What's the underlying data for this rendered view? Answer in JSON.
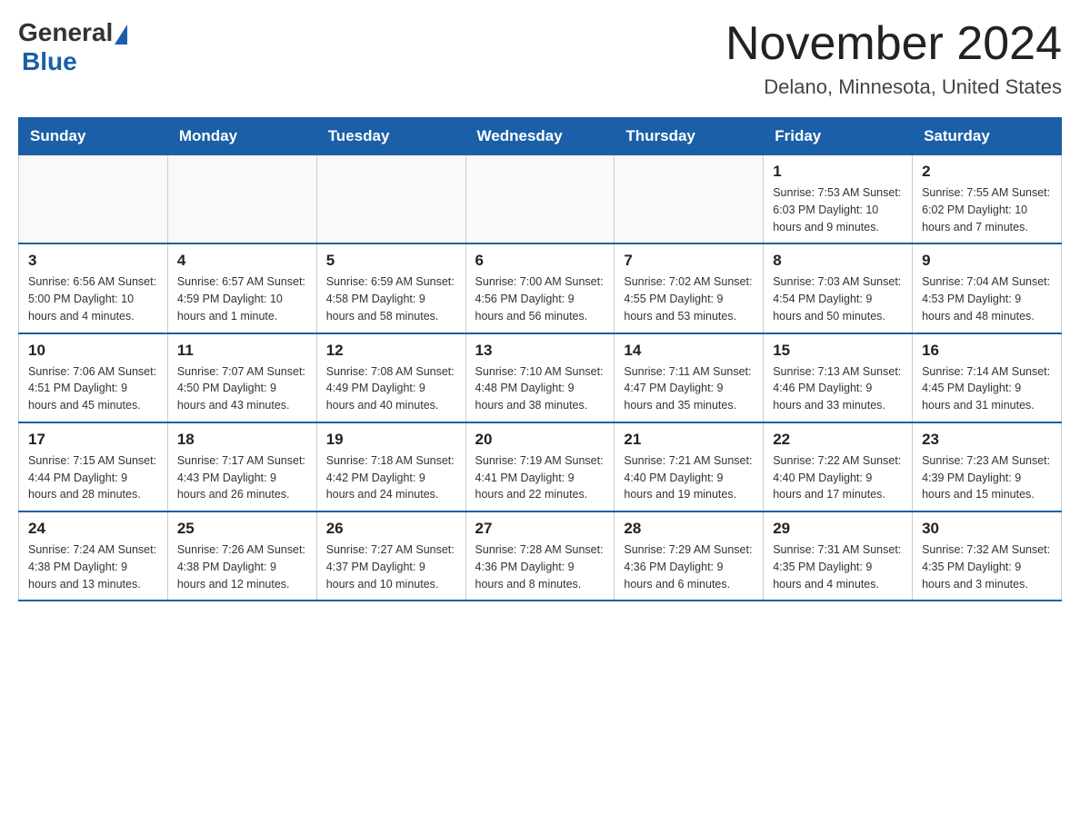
{
  "header": {
    "logo_general": "General",
    "logo_blue": "Blue",
    "month_title": "November 2024",
    "location": "Delano, Minnesota, United States"
  },
  "calendar": {
    "days_of_week": [
      "Sunday",
      "Monday",
      "Tuesday",
      "Wednesday",
      "Thursday",
      "Friday",
      "Saturday"
    ],
    "weeks": [
      [
        {
          "day": "",
          "info": ""
        },
        {
          "day": "",
          "info": ""
        },
        {
          "day": "",
          "info": ""
        },
        {
          "day": "",
          "info": ""
        },
        {
          "day": "",
          "info": ""
        },
        {
          "day": "1",
          "info": "Sunrise: 7:53 AM\nSunset: 6:03 PM\nDaylight: 10 hours and 9 minutes."
        },
        {
          "day": "2",
          "info": "Sunrise: 7:55 AM\nSunset: 6:02 PM\nDaylight: 10 hours and 7 minutes."
        }
      ],
      [
        {
          "day": "3",
          "info": "Sunrise: 6:56 AM\nSunset: 5:00 PM\nDaylight: 10 hours and 4 minutes."
        },
        {
          "day": "4",
          "info": "Sunrise: 6:57 AM\nSunset: 4:59 PM\nDaylight: 10 hours and 1 minute."
        },
        {
          "day": "5",
          "info": "Sunrise: 6:59 AM\nSunset: 4:58 PM\nDaylight: 9 hours and 58 minutes."
        },
        {
          "day": "6",
          "info": "Sunrise: 7:00 AM\nSunset: 4:56 PM\nDaylight: 9 hours and 56 minutes."
        },
        {
          "day": "7",
          "info": "Sunrise: 7:02 AM\nSunset: 4:55 PM\nDaylight: 9 hours and 53 minutes."
        },
        {
          "day": "8",
          "info": "Sunrise: 7:03 AM\nSunset: 4:54 PM\nDaylight: 9 hours and 50 minutes."
        },
        {
          "day": "9",
          "info": "Sunrise: 7:04 AM\nSunset: 4:53 PM\nDaylight: 9 hours and 48 minutes."
        }
      ],
      [
        {
          "day": "10",
          "info": "Sunrise: 7:06 AM\nSunset: 4:51 PM\nDaylight: 9 hours and 45 minutes."
        },
        {
          "day": "11",
          "info": "Sunrise: 7:07 AM\nSunset: 4:50 PM\nDaylight: 9 hours and 43 minutes."
        },
        {
          "day": "12",
          "info": "Sunrise: 7:08 AM\nSunset: 4:49 PM\nDaylight: 9 hours and 40 minutes."
        },
        {
          "day": "13",
          "info": "Sunrise: 7:10 AM\nSunset: 4:48 PM\nDaylight: 9 hours and 38 minutes."
        },
        {
          "day": "14",
          "info": "Sunrise: 7:11 AM\nSunset: 4:47 PM\nDaylight: 9 hours and 35 minutes."
        },
        {
          "day": "15",
          "info": "Sunrise: 7:13 AM\nSunset: 4:46 PM\nDaylight: 9 hours and 33 minutes."
        },
        {
          "day": "16",
          "info": "Sunrise: 7:14 AM\nSunset: 4:45 PM\nDaylight: 9 hours and 31 minutes."
        }
      ],
      [
        {
          "day": "17",
          "info": "Sunrise: 7:15 AM\nSunset: 4:44 PM\nDaylight: 9 hours and 28 minutes."
        },
        {
          "day": "18",
          "info": "Sunrise: 7:17 AM\nSunset: 4:43 PM\nDaylight: 9 hours and 26 minutes."
        },
        {
          "day": "19",
          "info": "Sunrise: 7:18 AM\nSunset: 4:42 PM\nDaylight: 9 hours and 24 minutes."
        },
        {
          "day": "20",
          "info": "Sunrise: 7:19 AM\nSunset: 4:41 PM\nDaylight: 9 hours and 22 minutes."
        },
        {
          "day": "21",
          "info": "Sunrise: 7:21 AM\nSunset: 4:40 PM\nDaylight: 9 hours and 19 minutes."
        },
        {
          "day": "22",
          "info": "Sunrise: 7:22 AM\nSunset: 4:40 PM\nDaylight: 9 hours and 17 minutes."
        },
        {
          "day": "23",
          "info": "Sunrise: 7:23 AM\nSunset: 4:39 PM\nDaylight: 9 hours and 15 minutes."
        }
      ],
      [
        {
          "day": "24",
          "info": "Sunrise: 7:24 AM\nSunset: 4:38 PM\nDaylight: 9 hours and 13 minutes."
        },
        {
          "day": "25",
          "info": "Sunrise: 7:26 AM\nSunset: 4:38 PM\nDaylight: 9 hours and 12 minutes."
        },
        {
          "day": "26",
          "info": "Sunrise: 7:27 AM\nSunset: 4:37 PM\nDaylight: 9 hours and 10 minutes."
        },
        {
          "day": "27",
          "info": "Sunrise: 7:28 AM\nSunset: 4:36 PM\nDaylight: 9 hours and 8 minutes."
        },
        {
          "day": "28",
          "info": "Sunrise: 7:29 AM\nSunset: 4:36 PM\nDaylight: 9 hours and 6 minutes."
        },
        {
          "day": "29",
          "info": "Sunrise: 7:31 AM\nSunset: 4:35 PM\nDaylight: 9 hours and 4 minutes."
        },
        {
          "day": "30",
          "info": "Sunrise: 7:32 AM\nSunset: 4:35 PM\nDaylight: 9 hours and 3 minutes."
        }
      ]
    ]
  }
}
